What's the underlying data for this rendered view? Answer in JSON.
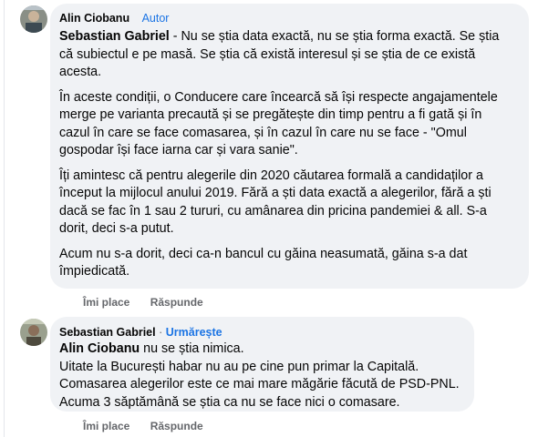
{
  "comments": [
    {
      "author": "Alin Ciobanu",
      "badge": "Autor",
      "mention": "Sebastian Gabriel",
      "first_text": " - Nu se știa data exactă, nu se știa forma exactă. Se știa că subiectul e pe masă. Se știa că există interesul și se știa de ce există acesta.",
      "paragraphs": [
        "În aceste condiții, o Conducere care încearcă să își respecte angajamentele merge pe varianta precaută și se pregătește din timp pentru a fi gată și în cazul în care se face comasarea, și în cazul în care nu se face - \"Omul gospodar își face iarna car și vara sanie\".",
        "Îți amintesc că pentru alegerile din 2020 căutarea formală a candidaților a început la mijlocul anului 2019. Fără a ști data exactă a alegerilor, fără a ști dacă se fac în 1 sau 2 tururi, cu amânarea din pricina pandemiei & all. S-a dorit, deci s-a putut.",
        "Acum nu s-a dorit, deci ca-n bancul cu găina neasumată, găina s-a dat împiedicată."
      ],
      "like_label": "Îmi place",
      "reply_label": "Răspunde"
    },
    {
      "author": "Sebastian Gabriel",
      "separator": "·",
      "follow_label": "Urmărește",
      "mention": "Alin Ciobanu",
      "first_text": " nu se știa nimica.",
      "lines": [
        "Uitate la București habar nu au pe cine pun primar la Capitală.",
        "Comasarea alegerilor este ce mai mare măgărie făcută de PSD-PNL.",
        "Acuma 3 săptămână se știa ca nu se face nici o comasare."
      ],
      "like_label": "Îmi place",
      "reply_label": "Răspunde"
    }
  ]
}
